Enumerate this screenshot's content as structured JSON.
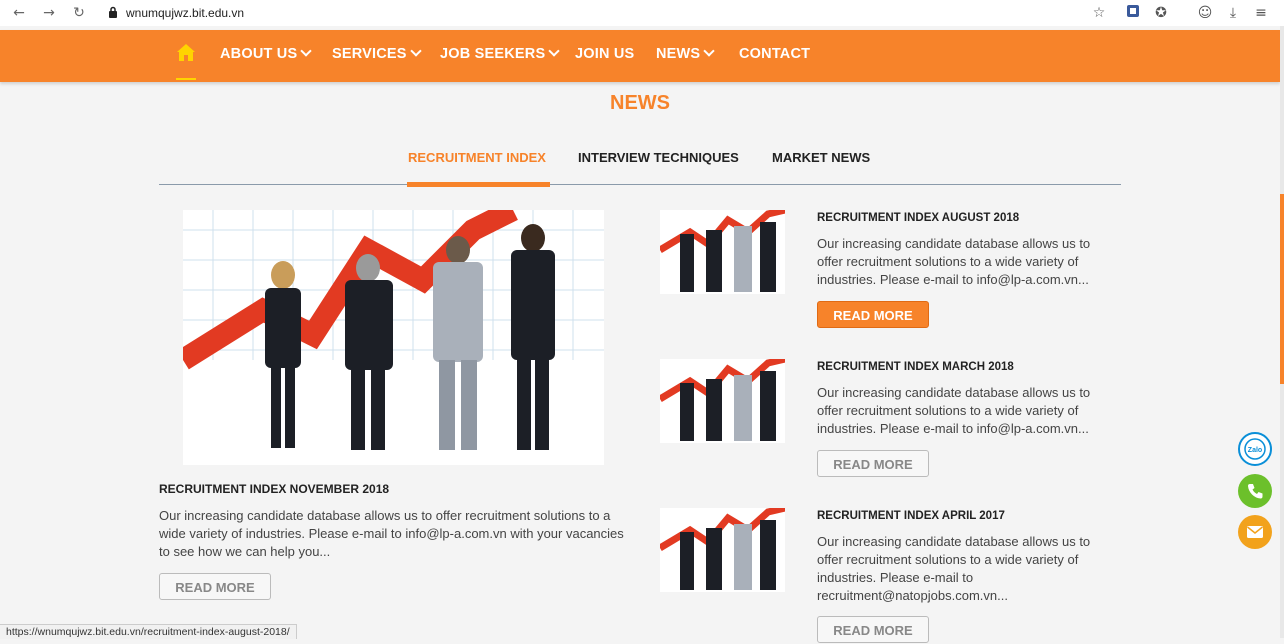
{
  "browser": {
    "url": "wnumqujwz.bit.edu.vn",
    "status_url": "https://wnumqujwz.bit.edu.vn/recruitment-index-august-2018/"
  },
  "nav": {
    "items": [
      {
        "label": "ABOUT US",
        "dropdown": true
      },
      {
        "label": "SERVICES",
        "dropdown": true
      },
      {
        "label": "JOB SEEKERS",
        "dropdown": true
      },
      {
        "label": "JOIN US",
        "dropdown": false
      },
      {
        "label": "NEWS",
        "dropdown": true
      },
      {
        "label": "CONTACT",
        "dropdown": false
      }
    ]
  },
  "section": {
    "title": "NEWS"
  },
  "tabs": [
    {
      "label": "RECRUITMENT INDEX",
      "active": true
    },
    {
      "label": "INTERVIEW TECHNIQUES",
      "active": false
    },
    {
      "label": "MARKET NEWS",
      "active": false
    }
  ],
  "featured": {
    "title": "RECRUITMENT INDEX NOVEMBER 2018",
    "excerpt": "Our increasing candidate database allows us to offer recruitment solutions to a wide variety of industries. Please e-mail to info@lp-a.com.vn with your vacancies to see how we can help you...",
    "button": "READ MORE"
  },
  "articles": [
    {
      "title": "RECRUITMENT INDEX AUGUST 2018",
      "excerpt": "Our increasing candidate database allows us to offer recruitment solutions to a wide variety of industries. Please e-mail to info@lp-a.com.vn...",
      "button": "READ MORE",
      "hovered": true
    },
    {
      "title": "RECRUITMENT INDEX MARCH 2018",
      "excerpt": "Our increasing candidate database allows us to offer recruitment solutions to a wide variety of industries. Please e-mail to info@lp-a.com.vn...",
      "button": "READ MORE",
      "hovered": false
    },
    {
      "title": "RECRUITMENT INDEX APRIL 2017",
      "excerpt": "Our increasing candidate database allows us to offer recruitment solutions to a wide variety of industries. Please e-mail to recruitment@natopjobs.com.vn...",
      "button": "READ MORE",
      "hovered": false
    }
  ],
  "floating": {
    "zalo_label": "Zalo"
  },
  "colors": {
    "brand": "#f7832a",
    "phone": "#6cc02b",
    "mail": "#f2a21c",
    "zalo": "#0a8fd8"
  }
}
